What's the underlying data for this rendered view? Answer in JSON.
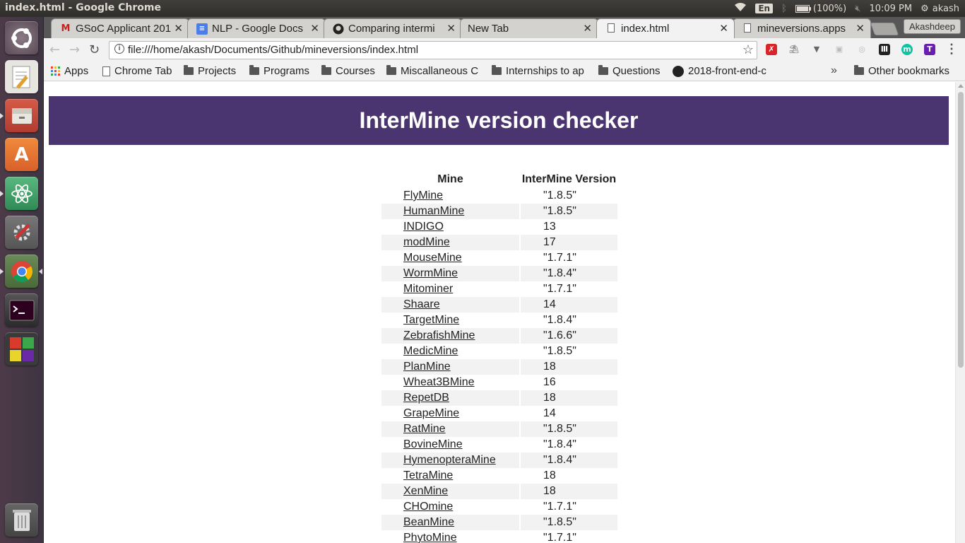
{
  "os": {
    "window_title": "index.html - Google Chrome",
    "lang_indicator": "En",
    "battery": "(100%)",
    "clock": "10:09 PM",
    "user": "akash"
  },
  "browser": {
    "tabs": [
      {
        "label": "GSoC Applicant 201",
        "icon": "gmail-icon"
      },
      {
        "label": "NLP - Google Docs",
        "icon": "docs-icon"
      },
      {
        "label": "Comparing intermi",
        "icon": "github-icon"
      },
      {
        "label": "New Tab",
        "icon": ""
      },
      {
        "label": "index.html",
        "icon": "page-icon",
        "active": true
      },
      {
        "label": "mineversions.apps",
        "icon": "page-icon"
      }
    ],
    "profile_name": "Akashdeep",
    "url": "file:///home/akash/Documents/Github/mineversions/index.html",
    "bookmarks": [
      {
        "label": "Apps",
        "icon": "apps-grid-icon"
      },
      {
        "label": "Chrome Tab",
        "icon": "page-icon"
      },
      {
        "label": "Projects",
        "icon": "folder-icon"
      },
      {
        "label": "Programs",
        "icon": "folder-icon"
      },
      {
        "label": "Courses",
        "icon": "folder-icon"
      },
      {
        "label": "Miscallaneous C",
        "icon": "folder-icon"
      },
      {
        "label": "Internships to ap",
        "icon": "folder-icon"
      },
      {
        "label": "Questions",
        "icon": "folder-icon"
      },
      {
        "label": "2018-front-end-c",
        "icon": "github-icon"
      }
    ],
    "bookmarks_overflow": "»",
    "other_bookmarks": "Other bookmarks"
  },
  "page": {
    "heading": "InterMine version checker",
    "columns": [
      "Mine",
      "InterMine Version"
    ],
    "rows": [
      {
        "mine": "FlyMine",
        "version": "\"1.8.5\""
      },
      {
        "mine": "HumanMine",
        "version": "\"1.8.5\""
      },
      {
        "mine": "INDIGO",
        "version": "13"
      },
      {
        "mine": "modMine",
        "version": "17"
      },
      {
        "mine": "MouseMine",
        "version": "\"1.7.1\""
      },
      {
        "mine": "WormMine",
        "version": "\"1.8.4\""
      },
      {
        "mine": "Mitominer",
        "version": "\"1.7.1\""
      },
      {
        "mine": "Shaare",
        "version": "14"
      },
      {
        "mine": "TargetMine",
        "version": "\"1.8.4\""
      },
      {
        "mine": "ZebrafishMine",
        "version": "\"1.6.6\""
      },
      {
        "mine": "MedicMine",
        "version": "\"1.8.5\""
      },
      {
        "mine": "PlanMine",
        "version": "18"
      },
      {
        "mine": "Wheat3BMine",
        "version": "16"
      },
      {
        "mine": "RepetDB",
        "version": "18"
      },
      {
        "mine": "GrapeMine",
        "version": "14"
      },
      {
        "mine": "RatMine",
        "version": "\"1.8.5\""
      },
      {
        "mine": "BovineMine",
        "version": "\"1.8.4\""
      },
      {
        "mine": "HymenopteraMine",
        "version": "\"1.8.4\""
      },
      {
        "mine": "TetraMine",
        "version": "18"
      },
      {
        "mine": "XenMine",
        "version": "18"
      },
      {
        "mine": "CHOmine",
        "version": "\"1.7.1\""
      },
      {
        "mine": "BeanMine",
        "version": "\"1.8.5\""
      },
      {
        "mine": "PhytoMine",
        "version": "\"1.7.1\""
      }
    ]
  },
  "colors": {
    "banner": "#4b3571",
    "row_alt": "#f2f2f2"
  }
}
